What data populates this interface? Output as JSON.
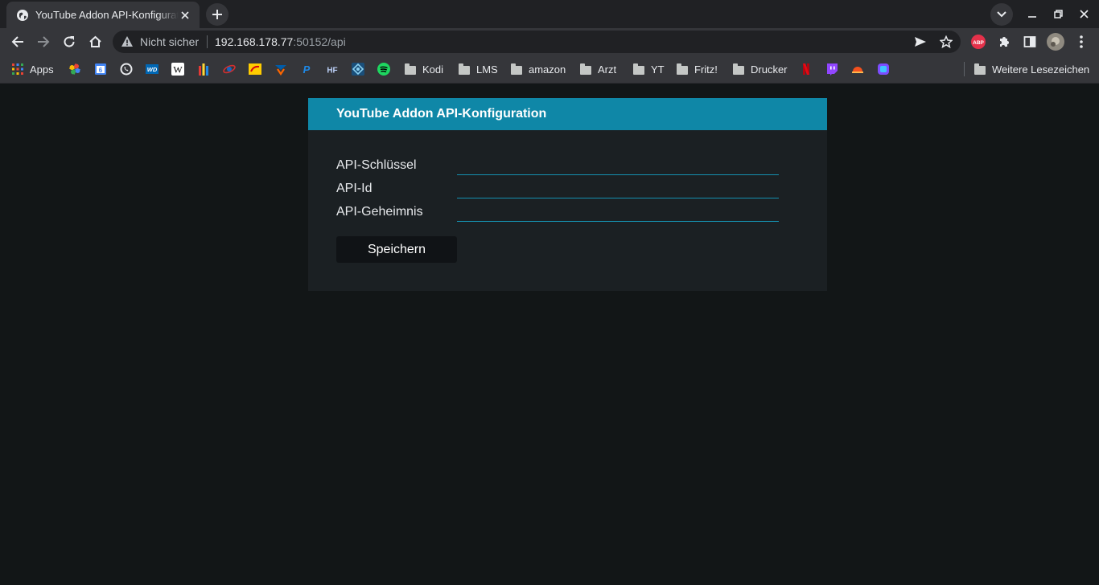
{
  "browser": {
    "tab_title": "YouTube Addon API-Konfiguration",
    "security_label": "Nicht sicher",
    "url_host": "192.168.178.77",
    "url_path": ":50152/api",
    "bookmarks": {
      "apps": "Apps",
      "kodi": "Kodi",
      "lms": "LMS",
      "amazon": "amazon",
      "arzt": "Arzt",
      "yt": "YT",
      "fritz": "Fritz!",
      "drucker": "Drucker",
      "weitere": "Weitere Lesezeichen"
    },
    "icon_texts": {
      "google_calendar": "6",
      "wd": "WD",
      "wikipedia": "W",
      "paypal": "P",
      "hf": "HF",
      "adblock": "ABP"
    }
  },
  "page": {
    "title": "YouTube Addon API-Konfiguration",
    "fields": [
      {
        "label": "API-Schlüssel",
        "value": ""
      },
      {
        "label": "API-Id",
        "value": ""
      },
      {
        "label": "API-Geheimnis",
        "value": ""
      }
    ],
    "save_label": "Speichern"
  },
  "colors": {
    "header_accent": "#0f87a7",
    "page_background": "#121617",
    "card_background": "#1b2023"
  }
}
